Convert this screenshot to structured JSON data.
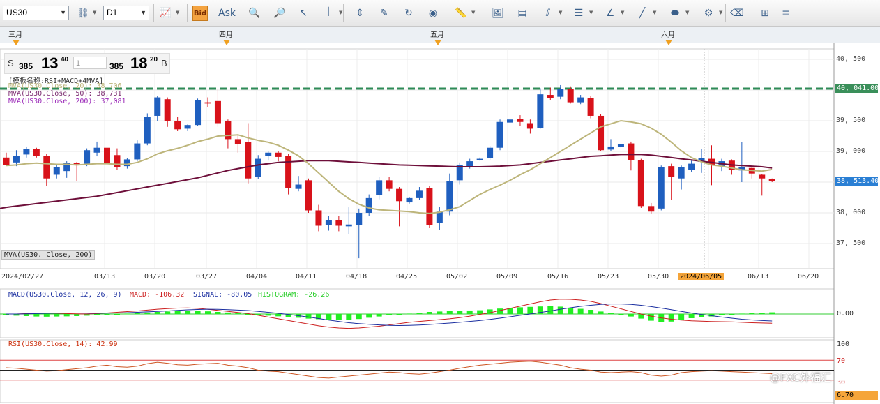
{
  "toolbar": {
    "symbol": "US30",
    "timeframe": "D1",
    "buttons": [
      {
        "name": "chart-type-icon",
        "glyph": "📈",
        "drop": true
      },
      {
        "name": "bid-button",
        "glyph": "Bid",
        "active": true
      },
      {
        "name": "ask-button",
        "glyph": "Ask"
      },
      {
        "name": "zoom-in-icon",
        "glyph": "🔍"
      },
      {
        "name": "zoom-out-icon",
        "glyph": "🔎"
      },
      {
        "name": "cursor-icon",
        "glyph": "↖"
      },
      {
        "name": "indicator-icon",
        "glyph": "ꟾ",
        "drop": true
      },
      {
        "name": "scale-icon",
        "glyph": "⇕"
      },
      {
        "name": "edit-icon",
        "glyph": "✎"
      },
      {
        "name": "refresh-icon",
        "glyph": "↻"
      },
      {
        "name": "globe-icon",
        "glyph": "◉"
      },
      {
        "name": "ruler-icon",
        "glyph": "📏",
        "drop": true
      },
      {
        "name": "image-icon",
        "glyph": "🖼"
      },
      {
        "name": "template-icon",
        "glyph": "▤"
      },
      {
        "name": "fibonacci-icon",
        "glyph": "⫽",
        "drop": true
      },
      {
        "name": "lines-icon",
        "glyph": "☰",
        "drop": true
      },
      {
        "name": "angle-icon",
        "glyph": "∠",
        "drop": true
      },
      {
        "name": "pencil-icon",
        "glyph": "╱",
        "drop": true
      },
      {
        "name": "ellipse-icon",
        "glyph": "⬬",
        "drop": true
      },
      {
        "name": "settings-grid-icon",
        "glyph": "⚙",
        "drop": true
      },
      {
        "name": "eraser-icon",
        "glyph": "⌫"
      },
      {
        "name": "tree-icon",
        "glyph": "⊞"
      },
      {
        "name": "more-icon",
        "glyph": "≡"
      }
    ]
  },
  "months": [
    "三月",
    "四月",
    "五月",
    "六月"
  ],
  "quote": {
    "sell_side": "S",
    "sell_small": "385",
    "sell_big": "13",
    "sell_sup": "40",
    "lots": "1",
    "buy_small": "385",
    "buy_big": "18",
    "buy_sup": "20",
    "buy_side": "B"
  },
  "info": {
    "template": "[模板名称:RSI+MACD+4MVA]",
    "mva1": "MVA(US30.Close, 20): 38,706",
    "mva2": "MVA(US30.Close, 50): 38,731",
    "mva3": "MVA(US30.Close, 200): 37,081",
    "bottom_label": "MVA(US30. Close, 200)"
  },
  "price_axis": [
    "40, 500",
    "40, 000",
    "39, 500",
    "39, 000",
    "38, 500",
    "38, 000",
    "37, 500"
  ],
  "flags": {
    "resistance": "40, 041.00",
    "current": "38, 513.40"
  },
  "date_axis": [
    "2024/02/27",
    "03/13",
    "03/20",
    "03/27",
    "04/04",
    "04/11",
    "04/18",
    "04/25",
    "05/02",
    "05/09",
    "05/16",
    "05/23",
    "05/30",
    "2024/06/05",
    "06/13",
    "06/20"
  ],
  "macd": {
    "title": "MACD(US30.Close, 12, 26, 9)",
    "macd_label": "MACD: -106.32",
    "signal_label": "SIGNAL: -80.05",
    "hist_label": "HISTOGRAM: -26.26",
    "axis": "0.00"
  },
  "rsi": {
    "title": "RSI(US30.Close, 14): 42.99",
    "axis_top": "100",
    "axis_70": "70",
    "axis_30": "30",
    "axis_current": "6.70"
  },
  "watermark": "@FXC外福汇",
  "colors": {
    "up": "#1f5fbf",
    "down": "#d8121a",
    "ma20": "#bdb57a",
    "ma200": "#6e0f3a",
    "resistance": "#2e8b57",
    "hist": "#22ee22",
    "macd": "#cc1f1f",
    "signal": "#1b2fa0"
  },
  "chart_data": {
    "type": "candlestick",
    "ylim": [
      37200,
      40800
    ],
    "candles": [
      {
        "o": 38900,
        "h": 38980,
        "l": 38770,
        "c": 38780
      },
      {
        "o": 38820,
        "h": 39020,
        "l": 38760,
        "c": 38930
      },
      {
        "o": 38950,
        "h": 39080,
        "l": 38900,
        "c": 39040
      },
      {
        "o": 39040,
        "h": 39060,
        "l": 38900,
        "c": 38930
      },
      {
        "o": 38930,
        "h": 38960,
        "l": 38440,
        "c": 38560
      },
      {
        "o": 38620,
        "h": 38780,
        "l": 38560,
        "c": 38740
      },
      {
        "o": 38680,
        "h": 38840,
        "l": 38570,
        "c": 38810
      },
      {
        "o": 38810,
        "h": 38830,
        "l": 38520,
        "c": 38800
      },
      {
        "o": 38800,
        "h": 39050,
        "l": 38760,
        "c": 39020
      },
      {
        "o": 38980,
        "h": 39160,
        "l": 38920,
        "c": 39060
      },
      {
        "o": 39060,
        "h": 39110,
        "l": 38720,
        "c": 38800
      },
      {
        "o": 38940,
        "h": 39050,
        "l": 38700,
        "c": 38750
      },
      {
        "o": 38760,
        "h": 38890,
        "l": 38720,
        "c": 38870
      },
      {
        "o": 38870,
        "h": 39180,
        "l": 38840,
        "c": 39130
      },
      {
        "o": 39130,
        "h": 39620,
        "l": 39100,
        "c": 39560
      },
      {
        "o": 39580,
        "h": 39900,
        "l": 39500,
        "c": 39880
      },
      {
        "o": 39850,
        "h": 39880,
        "l": 39400,
        "c": 39500
      },
      {
        "o": 39500,
        "h": 39560,
        "l": 39330,
        "c": 39360
      },
      {
        "o": 39370,
        "h": 39440,
        "l": 39330,
        "c": 39430
      },
      {
        "o": 39430,
        "h": 39860,
        "l": 39410,
        "c": 39830
      },
      {
        "o": 39800,
        "h": 39880,
        "l": 39720,
        "c": 39780
      },
      {
        "o": 39820,
        "h": 40020,
        "l": 39400,
        "c": 39460
      },
      {
        "o": 39500,
        "h": 39520,
        "l": 39050,
        "c": 39200
      },
      {
        "o": 39200,
        "h": 39280,
        "l": 38980,
        "c": 39120
      },
      {
        "o": 39150,
        "h": 39460,
        "l": 38480,
        "c": 38560
      },
      {
        "o": 38590,
        "h": 38940,
        "l": 38550,
        "c": 38880
      },
      {
        "o": 38930,
        "h": 39000,
        "l": 38850,
        "c": 38980
      },
      {
        "o": 38980,
        "h": 39010,
        "l": 38840,
        "c": 38910
      },
      {
        "o": 38930,
        "h": 38960,
        "l": 38300,
        "c": 38400
      },
      {
        "o": 38390,
        "h": 38600,
        "l": 38350,
        "c": 38460
      },
      {
        "o": 38530,
        "h": 38560,
        "l": 38000,
        "c": 38040
      },
      {
        "o": 38040,
        "h": 38130,
        "l": 37700,
        "c": 37790
      },
      {
        "o": 37800,
        "h": 37950,
        "l": 37710,
        "c": 37880
      },
      {
        "o": 37880,
        "h": 37950,
        "l": 37700,
        "c": 37790
      },
      {
        "o": 37780,
        "h": 38090,
        "l": 37650,
        "c": 37810
      },
      {
        "o": 37800,
        "h": 38070,
        "l": 37260,
        "c": 38000
      },
      {
        "o": 38000,
        "h": 38300,
        "l": 37950,
        "c": 38240
      },
      {
        "o": 38290,
        "h": 38580,
        "l": 38220,
        "c": 38530
      },
      {
        "o": 38530,
        "h": 38590,
        "l": 38350,
        "c": 38390
      },
      {
        "o": 38390,
        "h": 38420,
        "l": 37780,
        "c": 38190
      },
      {
        "o": 38170,
        "h": 38260,
        "l": 38150,
        "c": 38240
      },
      {
        "o": 38240,
        "h": 38420,
        "l": 38210,
        "c": 38360
      },
      {
        "o": 38400,
        "h": 38440,
        "l": 37750,
        "c": 37800
      },
      {
        "o": 37830,
        "h": 38100,
        "l": 37720,
        "c": 38020
      },
      {
        "o": 38020,
        "h": 38640,
        "l": 37960,
        "c": 38520
      },
      {
        "o": 38530,
        "h": 38820,
        "l": 38460,
        "c": 38780
      },
      {
        "o": 38760,
        "h": 38880,
        "l": 38720,
        "c": 38840
      },
      {
        "o": 38870,
        "h": 38900,
        "l": 38850,
        "c": 38880
      },
      {
        "o": 38890,
        "h": 39090,
        "l": 38860,
        "c": 39060
      },
      {
        "o": 39060,
        "h": 39520,
        "l": 39020,
        "c": 39480
      },
      {
        "o": 39470,
        "h": 39540,
        "l": 39440,
        "c": 39520
      },
      {
        "o": 39530,
        "h": 39590,
        "l": 39420,
        "c": 39480
      },
      {
        "o": 39460,
        "h": 39520,
        "l": 39290,
        "c": 39370
      },
      {
        "o": 39380,
        "h": 40030,
        "l": 39370,
        "c": 39930
      },
      {
        "o": 39920,
        "h": 40040,
        "l": 39830,
        "c": 39870
      },
      {
        "o": 39890,
        "h": 40080,
        "l": 39850,
        "c": 40020
      },
      {
        "o": 40020,
        "h": 40060,
        "l": 39780,
        "c": 39800
      },
      {
        "o": 39800,
        "h": 39920,
        "l": 39770,
        "c": 39880
      },
      {
        "o": 39870,
        "h": 39900,
        "l": 39540,
        "c": 39580
      },
      {
        "o": 39580,
        "h": 39610,
        "l": 39010,
        "c": 39020
      },
      {
        "o": 39030,
        "h": 39200,
        "l": 39000,
        "c": 39080
      },
      {
        "o": 39070,
        "h": 39120,
        "l": 39060,
        "c": 39120
      },
      {
        "o": 39130,
        "h": 39160,
        "l": 38690,
        "c": 38860
      },
      {
        "o": 38860,
        "h": 38880,
        "l": 38080,
        "c": 38110
      },
      {
        "o": 38110,
        "h": 38160,
        "l": 37990,
        "c": 38020
      },
      {
        "o": 38070,
        "h": 38770,
        "l": 38040,
        "c": 38740
      },
      {
        "o": 38760,
        "h": 38800,
        "l": 38210,
        "c": 38580
      },
      {
        "o": 38560,
        "h": 38770,
        "l": 38380,
        "c": 38740
      },
      {
        "o": 38700,
        "h": 38850,
        "l": 38660,
        "c": 38800
      },
      {
        "o": 38830,
        "h": 39040,
        "l": 38650,
        "c": 38890
      },
      {
        "o": 38880,
        "h": 39100,
        "l": 38450,
        "c": 38780
      },
      {
        "o": 38760,
        "h": 38880,
        "l": 38680,
        "c": 38840
      },
      {
        "o": 38850,
        "h": 38870,
        "l": 38620,
        "c": 38700
      },
      {
        "o": 38690,
        "h": 39150,
        "l": 38500,
        "c": 38740
      },
      {
        "o": 38730,
        "h": 38760,
        "l": 38560,
        "c": 38640
      },
      {
        "o": 38620,
        "h": 38630,
        "l": 38280,
        "c": 38560
      },
      {
        "o": 38550,
        "h": 38560,
        "l": 38500,
        "c": 38513
      }
    ],
    "ma20": [
      38770,
      38780,
      38800,
      38810,
      38800,
      38790,
      38790,
      38780,
      38790,
      38800,
      38800,
      38790,
      38790,
      38820,
      38880,
      38960,
      39010,
      39050,
      39100,
      39160,
      39200,
      39250,
      39260,
      39270,
      39220,
      39180,
      39150,
      39100,
      39020,
      38930,
      38800,
      38650,
      38500,
      38350,
      38230,
      38140,
      38080,
      38050,
      38040,
      38030,
      38020,
      38000,
      37990,
      38010,
      38050,
      38100,
      38200,
      38300,
      38380,
      38450,
      38530,
      38620,
      38700,
      38800,
      38900,
      39000,
      39100,
      39200,
      39300,
      39400,
      39450,
      39500,
      39480,
      39450,
      39380,
      39280,
      39150,
      39010,
      38900,
      38830,
      38780,
      38760,
      38730,
      38700,
      38690,
      38680,
      38706
    ],
    "ma200": [
      38090,
      38110,
      38130,
      38150,
      38170,
      38190,
      38210,
      38230,
      38250,
      38270,
      38300,
      38330,
      38360,
      38390,
      38420,
      38450,
      38480,
      38510,
      38540,
      38570,
      38610,
      38650,
      38690,
      38720,
      38750,
      38780,
      38800,
      38820,
      38830,
      38840,
      38850,
      38850,
      38850,
      38840,
      38830,
      38820,
      38810,
      38800,
      38790,
      38780,
      38775,
      38770,
      38765,
      38760,
      38755,
      38750,
      38750,
      38750,
      38755,
      38760,
      38770,
      38780,
      38800,
      38820,
      38840,
      38860,
      38880,
      38900,
      38920,
      38930,
      38940,
      38950,
      38950,
      38950,
      38940,
      38920,
      38900,
      38880,
      38860,
      38840,
      38820,
      38800,
      38780,
      38770,
      38760,
      38750,
      38731
    ],
    "macd_hist": [
      -10,
      -20,
      -25,
      -30,
      -32,
      -30,
      -28,
      -25,
      -20,
      -12,
      -5,
      0,
      5,
      10,
      18,
      25,
      30,
      35,
      40,
      38,
      32,
      25,
      18,
      12,
      -5,
      -15,
      -20,
      -28,
      -35,
      -45,
      -55,
      -62,
      -70,
      -75,
      -70,
      -60,
      -45,
      -30,
      -15,
      -5,
      5,
      15,
      25,
      30,
      35,
      40,
      42,
      45,
      55,
      65,
      75,
      80,
      85,
      90,
      95,
      88,
      75,
      62,
      50,
      30,
      10,
      -10,
      -30,
      -55,
      -80,
      -95,
      -90,
      -70,
      -50,
      -40,
      -30,
      -15,
      -5,
      5,
      10,
      15,
      20
    ],
    "macd_line": [
      0,
      0,
      5,
      8,
      10,
      8,
      5,
      2,
      0,
      5,
      12,
      20,
      28,
      35,
      45,
      55,
      62,
      68,
      70,
      65,
      55,
      42,
      30,
      18,
      5,
      -15,
      -35,
      -55,
      -75,
      -95,
      -115,
      -135,
      -150,
      -160,
      -165,
      -160,
      -150,
      -140,
      -125,
      -110,
      -95,
      -85,
      -75,
      -65,
      -55,
      -42,
      -25,
      -5,
      15,
      40,
      65,
      90,
      115,
      140,
      160,
      170,
      168,
      160,
      145,
      120,
      90,
      60,
      30,
      0,
      -25,
      -45,
      -60,
      -70,
      -78,
      -82,
      -86,
      -88,
      -90,
      -95,
      -100,
      -103,
      -106
    ],
    "signal_line": [
      0,
      0,
      2,
      5,
      8,
      10,
      12,
      12,
      10,
      9,
      10,
      12,
      15,
      20,
      25,
      30,
      35,
      42,
      48,
      52,
      55,
      54,
      50,
      45,
      40,
      30,
      20,
      8,
      -5,
      -20,
      -35,
      -52,
      -70,
      -85,
      -100,
      -110,
      -118,
      -125,
      -130,
      -132,
      -130,
      -126,
      -120,
      -112,
      -104,
      -95,
      -85,
      -75,
      -62,
      -48,
      -32,
      -15,
      0,
      18,
      35,
      55,
      72,
      88,
      100,
      110,
      115,
      115,
      110,
      100,
      85,
      68,
      50,
      30,
      12,
      -5,
      -20,
      -35,
      -48,
      -60,
      -68,
      -75,
      -80
    ],
    "rsi": [
      55,
      54,
      52,
      50,
      48,
      49,
      51,
      53,
      55,
      58,
      60,
      57,
      56,
      58,
      63,
      66,
      64,
      61,
      60,
      62,
      63,
      64,
      60,
      58,
      55,
      50,
      48,
      47,
      44,
      41,
      38,
      35,
      34,
      36,
      38,
      40,
      42,
      44,
      46,
      45,
      43,
      42,
      44,
      47,
      50,
      54,
      57,
      60,
      62,
      64,
      66,
      67,
      68,
      66,
      63,
      60,
      55,
      52,
      50,
      46,
      45,
      46,
      47,
      45,
      40,
      38,
      40,
      45,
      47,
      48,
      49,
      48,
      47,
      46,
      45,
      44,
      43
    ]
  }
}
